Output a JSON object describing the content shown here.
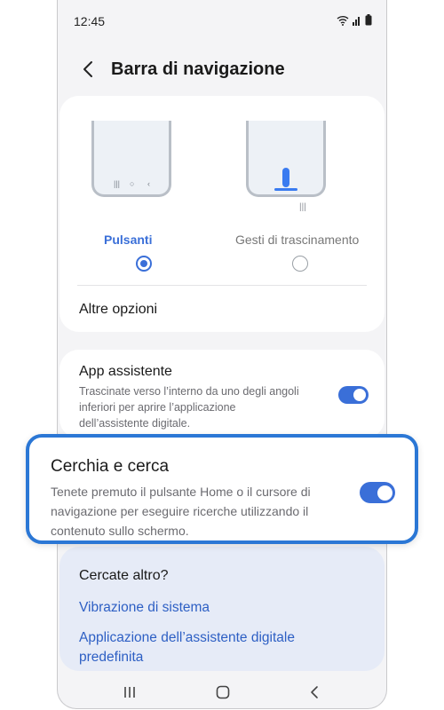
{
  "status": {
    "time": "12:45"
  },
  "header": {
    "title": "Barra di navigazione"
  },
  "nav_options": {
    "buttons_label": "Pulsanti",
    "gestures_label": "Gesti di trascinamento",
    "selected": "Pulsanti",
    "more_options": "Altre opzioni"
  },
  "assistant": {
    "title": "App assistente",
    "description": "Trascinate verso l’interno da uno degli angoli inferiori per aprire l’applicazione dell’assistente digitale.",
    "enabled": true
  },
  "circle_search": {
    "title": "Cerchia e cerca",
    "description": "Tenete premuto il pulsante Home o il cursore di navigazione per eseguire ricerche utilizzando il contenuto sullo schermo.",
    "enabled": true
  },
  "more": {
    "title": "Cercate altro?",
    "links": [
      "Vibrazione di sistema",
      "Applicazione dell’assistente digitale predefinita"
    ]
  },
  "colors": {
    "accent": "#3a6fd8",
    "highlight_border": "#2b77d5",
    "link": "#2d5fc4"
  }
}
